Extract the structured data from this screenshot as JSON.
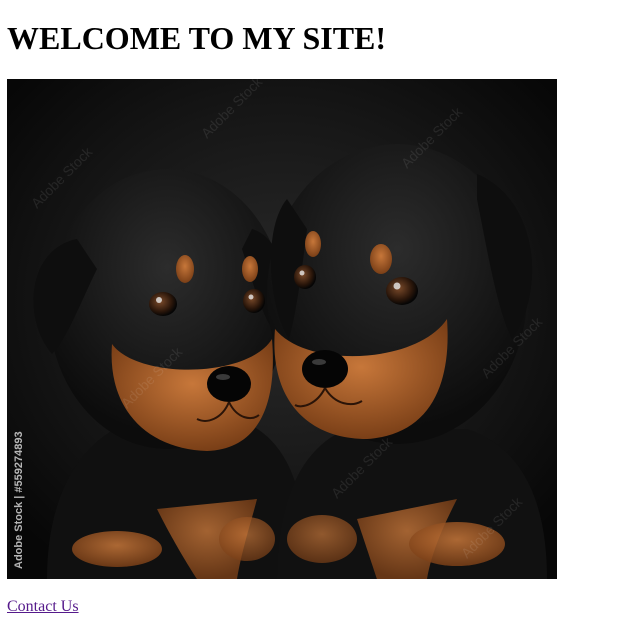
{
  "page": {
    "heading": "WELCOME TO MY SITE!"
  },
  "hero_image": {
    "subject": "two rottweiler puppies",
    "watermark_brand": "Adobe Stock",
    "stock_id_text": "Adobe Stock | #559274893"
  },
  "footer": {
    "contact_link": "Contact Us"
  },
  "colors": {
    "link_visited": "#551a8b",
    "image_background": "#0d0d0d",
    "puppy_fur_black": "#141414",
    "puppy_fur_tan": "#b0602a"
  }
}
